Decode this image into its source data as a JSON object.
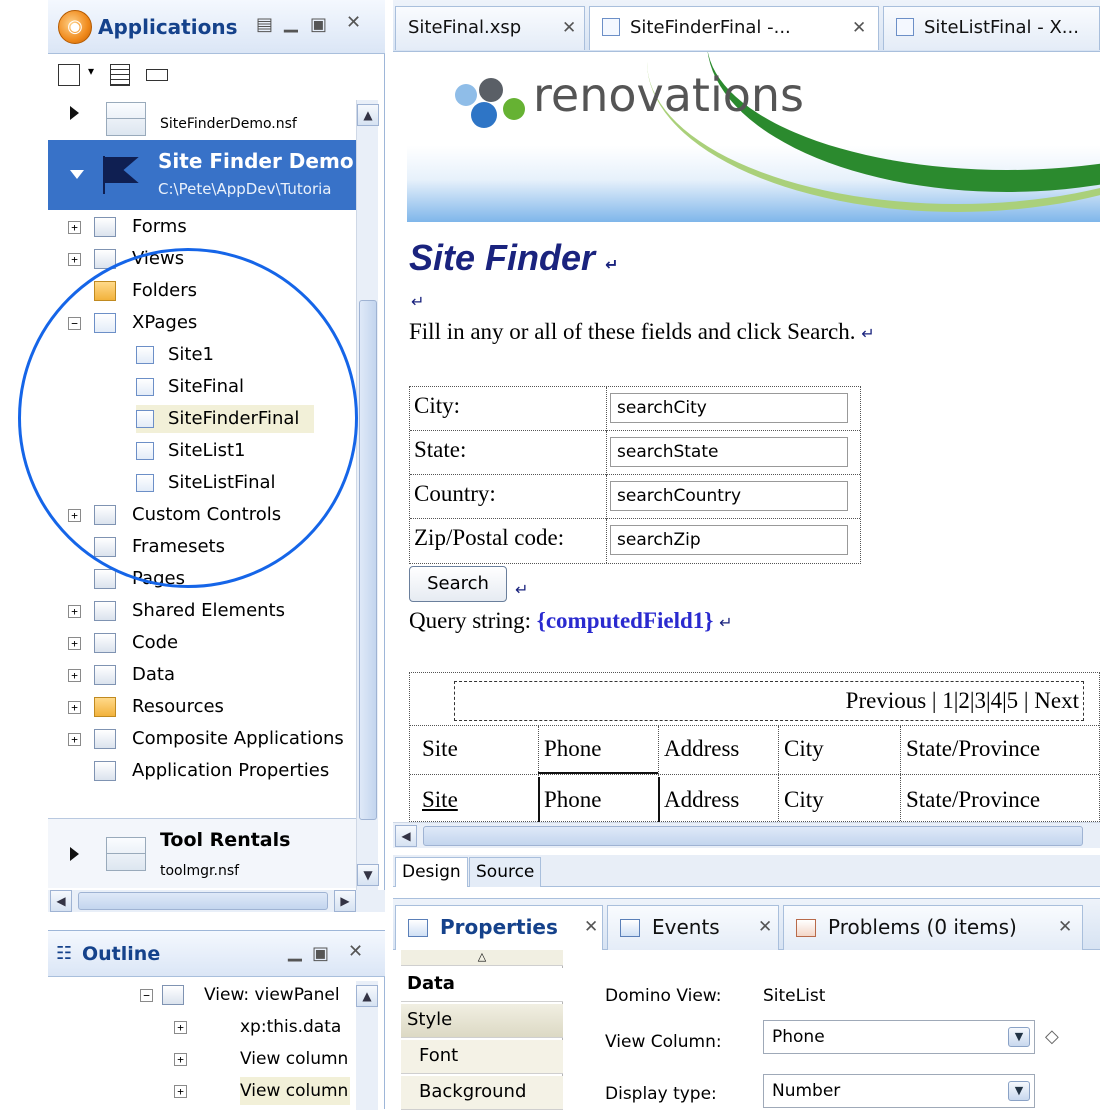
{
  "apps_panel": {
    "title": "Applications",
    "databases": [
      {
        "file": "SiteFinderDemo.nsf"
      },
      {
        "title": "Site Finder Demo",
        "path": "C:\\Pete\\AppDev\\Tutoria"
      },
      {
        "title": "Tool Rentals",
        "file": "toolmgr.nsf"
      }
    ],
    "tree": {
      "forms": "Forms",
      "views": "Views",
      "folders": "Folders",
      "xpages": "XPages",
      "xpage_items": [
        "Site1",
        "SiteFinal",
        "SiteFinderFinal",
        "SiteList1",
        "SiteListFinal"
      ],
      "custom_controls": "Custom Controls",
      "framesets": "Framesets",
      "pages": "Pages",
      "shared_elements": "Shared Elements",
      "code": "Code",
      "data": "Data",
      "resources": "Resources",
      "composite_applications": "Composite Applications",
      "application_properties": "Application Properties"
    },
    "selected_item": "SiteFinderFinal"
  },
  "outline_panel": {
    "title": "Outline",
    "items": [
      {
        "label": "View: viewPanel"
      },
      {
        "label": "xp:this.data"
      },
      {
        "label": "View column"
      },
      {
        "label": "View column"
      }
    ]
  },
  "editor": {
    "tabs": [
      {
        "label": "SiteFinal.xsp"
      },
      {
        "label": "SiteFinderFinal -..."
      },
      {
        "label": "SiteListFinal - X..."
      }
    ],
    "logo_text": "renovations",
    "page_title": "Site Finder",
    "return_mark": "↵",
    "instruction": "Fill in any or all of these fields and click Search.",
    "fields": [
      {
        "label": "City:",
        "value": "searchCity"
      },
      {
        "label": "State:",
        "value": "searchState"
      },
      {
        "label": "Country:",
        "value": "searchCountry"
      },
      {
        "label": "Zip/Postal code:",
        "value": "searchZip"
      }
    ],
    "search_button": "Search",
    "query_label": "Query string:",
    "computed_field": "{computedField1}",
    "pager": "Previous | 1|2|3|4|5 | Next",
    "columns": [
      "Site",
      "Phone",
      "Address",
      "City",
      "State/Province"
    ],
    "row_values": [
      "Site",
      "Phone",
      "Address",
      "City",
      "State/Province"
    ],
    "mode_tabs": [
      "Design",
      "Source"
    ]
  },
  "bottom": {
    "tabs": [
      {
        "label": "Properties"
      },
      {
        "label": "Events"
      },
      {
        "label": "Problems (0 items)"
      }
    ],
    "nav": [
      "Data",
      "Style",
      "Font",
      "Background"
    ],
    "props": {
      "domino_view_label": "Domino View:",
      "domino_view_value": "SiteList",
      "view_column_label": "View Column:",
      "view_column_value": "Phone",
      "display_type_label": "Display type:",
      "display_type_value": "Number"
    }
  },
  "colors": {
    "selection": "#3872c8",
    "annotation": "#1565e8",
    "title_blue": "#1a237e"
  }
}
